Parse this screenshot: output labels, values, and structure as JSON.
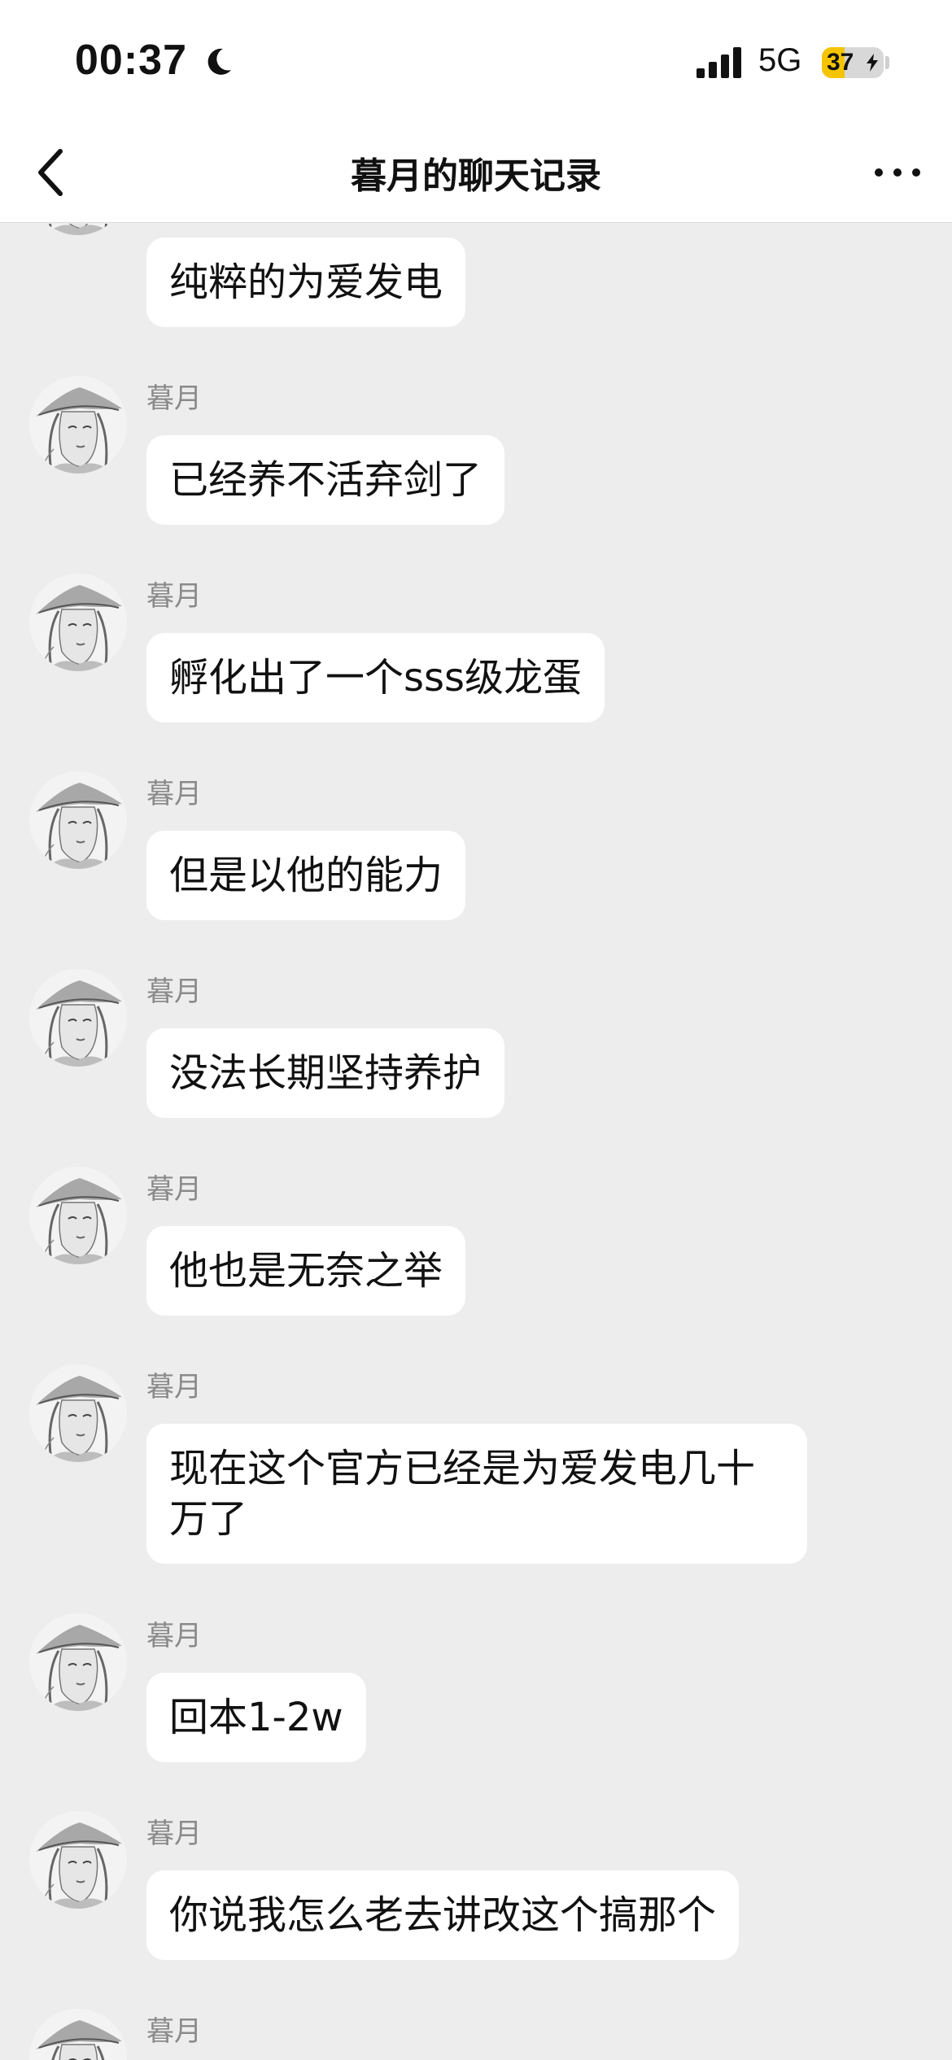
{
  "status_bar": {
    "time": "00:37",
    "network": "5G",
    "battery_level": "37",
    "battery_fraction": 0.37,
    "battery_charging": true,
    "icons": [
      "moon-icon",
      "signal-icon",
      "battery-icon",
      "bolt-icon"
    ]
  },
  "nav": {
    "title": "暮月的聊天记录",
    "back_icon": "chevron-left-icon",
    "more_icon": "more-horizontal-icon"
  },
  "colors": {
    "background": "#ededed",
    "bubble": "#ffffff",
    "sender_name": "#8a8a8a",
    "battery_fill": "#f5c400"
  },
  "messages": [
    {
      "sender": "",
      "text": "纯粹的为爱发电"
    },
    {
      "sender": "暮月",
      "text": "已经养不活弃剑了"
    },
    {
      "sender": "暮月",
      "text": "孵化出了一个sss级龙蛋"
    },
    {
      "sender": "暮月",
      "text": "但是以他的能力"
    },
    {
      "sender": "暮月",
      "text": "没法长期坚持养护"
    },
    {
      "sender": "暮月",
      "text": "他也是无奈之举"
    },
    {
      "sender": "暮月",
      "text": "现在这个官方已经是为爱发电几十万了"
    },
    {
      "sender": "暮月",
      "text": "回本1-2w"
    },
    {
      "sender": "暮月",
      "text": "你说我怎么老去讲改这个搞那个"
    },
    {
      "sender": "暮月",
      "text": ""
    }
  ]
}
